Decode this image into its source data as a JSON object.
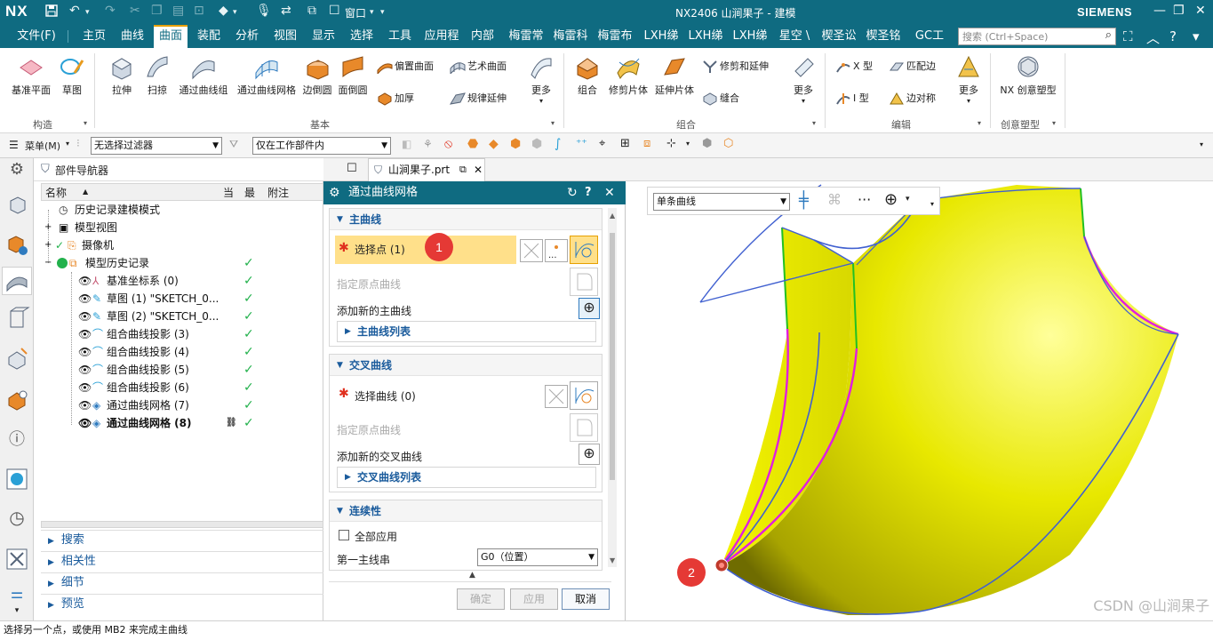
{
  "titlebar": {
    "logo": "NX",
    "window_menu": "窗口",
    "title": "NX2406 山涧果子 - 建模",
    "brand": "SIEMENS"
  },
  "menubar": {
    "items": [
      {
        "label": "文件(F)"
      },
      {
        "label": "主页"
      },
      {
        "label": "曲线"
      },
      {
        "label": "曲面",
        "active": true
      },
      {
        "label": "装配"
      },
      {
        "label": "分析"
      },
      {
        "label": "视图"
      },
      {
        "label": "显示"
      },
      {
        "label": "选择"
      },
      {
        "label": "工具"
      },
      {
        "label": "应用程"
      },
      {
        "label": "内部"
      },
      {
        "label": "梅雷常"
      },
      {
        "label": "梅雷科"
      },
      {
        "label": "梅雷布"
      },
      {
        "label": "LXH绨"
      },
      {
        "label": "LXH绨"
      },
      {
        "label": "LXH绨"
      },
      {
        "label": "星空 \\"
      },
      {
        "label": "楔圣讼"
      },
      {
        "label": "楔圣铭"
      },
      {
        "label": "GC工"
      }
    ],
    "search_placeholder": "搜索 (Ctrl+Space)"
  },
  "ribbon": {
    "build_group": {
      "label": "构造",
      "items": [
        "基准平面",
        "草图"
      ]
    },
    "basic_group": {
      "label": "基本",
      "items": [
        "拉伸",
        "扫掠",
        "通过曲线组",
        "通过曲线网格",
        "边倒圆",
        "面倒圆"
      ],
      "small": [
        "偏置曲面",
        "加厚",
        "艺术曲面",
        "规律延伸"
      ],
      "more": "更多"
    },
    "combine_group": {
      "label": "组合",
      "items": [
        "组合",
        "修剪片体",
        "延伸片体"
      ],
      "small": [
        "修剪和延伸",
        "缝合"
      ],
      "more": "更多"
    },
    "edit_group": {
      "label": "编辑",
      "small": [
        "X 型",
        "I 型",
        "匹配边",
        "边对称"
      ],
      "more": "更多"
    },
    "freeform_group": {
      "label": "创意塑型",
      "items": [
        "NX 创意塑型"
      ]
    }
  },
  "filterbar": {
    "menu_label": "菜单(M)",
    "filter_value": "无选择过滤器",
    "scope_value": "仅在工作部件内"
  },
  "part_navigator": {
    "title": "部件导航器",
    "columns": {
      "name": "名称",
      "current": "当",
      "latest": "最",
      "note": "附注"
    },
    "rows": [
      {
        "label": "历史记录建模模式"
      },
      {
        "label": "模型视图"
      },
      {
        "label": "摄像机"
      },
      {
        "label": "模型历史记录"
      },
      {
        "label": "基准坐标系 (0)"
      },
      {
        "label": "草图 (1) \"SKETCH_0..."
      },
      {
        "label": "草图 (2) \"SKETCH_0..."
      },
      {
        "label": "组合曲线投影 (3)"
      },
      {
        "label": "组合曲线投影 (4)"
      },
      {
        "label": "组合曲线投影 (5)"
      },
      {
        "label": "组合曲线投影 (6)"
      },
      {
        "label": "通过曲线网格 (7)"
      },
      {
        "label": "通过曲线网格 (8)"
      }
    ],
    "panels": [
      "搜索",
      "相关性",
      "细节",
      "预览"
    ]
  },
  "tabs": {
    "file_tab": "山涧果子.prt"
  },
  "dialog": {
    "title": "通过曲线网格",
    "primary": {
      "header": "主曲线",
      "select_points": "选择点 (1)",
      "origin_curve": "指定原点曲线",
      "add_new": "添加新的主曲线",
      "list": "主曲线列表"
    },
    "cross": {
      "header": "交叉曲线",
      "select_curve": "选择曲线 (0)",
      "origin_curve": "指定原点曲线",
      "add_new": "添加新的交叉曲线",
      "list": "交叉曲线列表"
    },
    "continuity": {
      "header": "连续性",
      "apply_all": "全部应用",
      "first_primary": "第一主线串",
      "first_primary_value": "G0（位置）"
    },
    "buttons": {
      "ok": "确定",
      "apply": "应用",
      "cancel": "取消"
    }
  },
  "viewport": {
    "curve_rule": "单条曲线",
    "markers": [
      "1",
      "2"
    ],
    "watermark": "CSDN @山涧果子"
  },
  "status": {
    "message": "选择另一个点，或使用 MB2 来完成主曲线"
  },
  "colors": {
    "chrome": "#0f6b81",
    "surface": "#e8e800",
    "highlight": "#ffe08a",
    "marker": "#e53935"
  }
}
